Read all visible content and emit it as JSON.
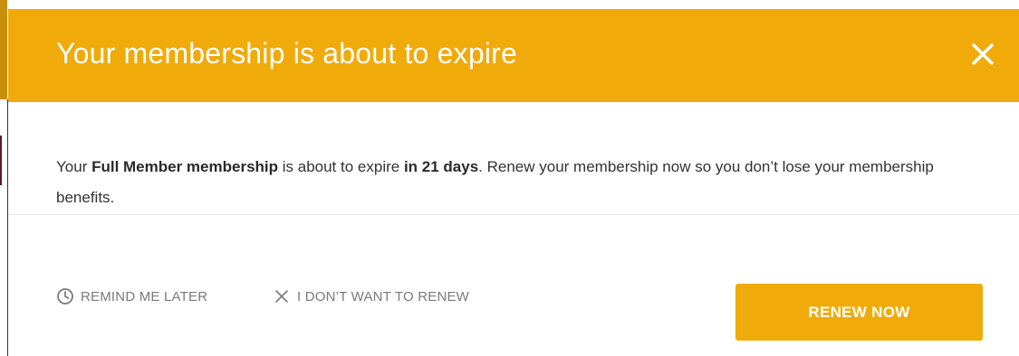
{
  "modal": {
    "title": "Your membership is about to expire",
    "message": {
      "part1": "Your ",
      "membership_type": "Full Member membership",
      "part2": " is about to expire ",
      "time_left": "in 21 days",
      "part3": ". Renew your membership now so you don’t lose your membership benefits."
    },
    "footer": {
      "remind_label": "REMIND ME LATER",
      "decline_label": "I DON’T WANT TO RENEW",
      "renew_label": "RENEW NOW"
    },
    "icons": {
      "close": "close-icon",
      "remind": "clock-icon",
      "decline": "x-icon"
    },
    "colors": {
      "accent": "#f0ab0a",
      "text": "#333333",
      "muted": "#7a7a7a"
    }
  }
}
